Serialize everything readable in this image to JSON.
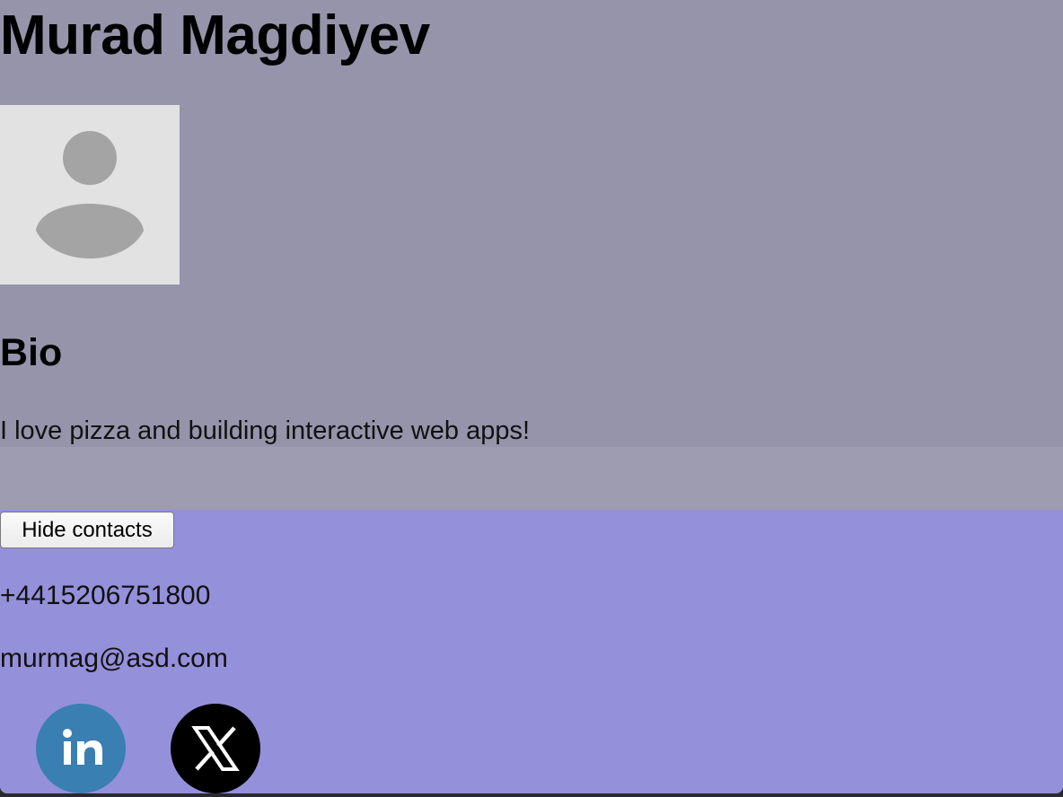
{
  "profile": {
    "name": "Murad Magdiyev",
    "avatar_icon": "user-placeholder-icon",
    "bio_heading": "Bio",
    "bio_text": "I love pizza and building interactive web apps!"
  },
  "contacts": {
    "toggle_label": "Hide contacts",
    "phone": "+4415206751800",
    "email": "murmag@asd.com",
    "social": [
      {
        "icon": "linkedin-icon",
        "color": "#3a7fb1"
      },
      {
        "icon": "x-icon",
        "color": "#000000"
      }
    ]
  },
  "colors": {
    "profile_background": "#9694aa",
    "contacts_background": "#9490da"
  }
}
